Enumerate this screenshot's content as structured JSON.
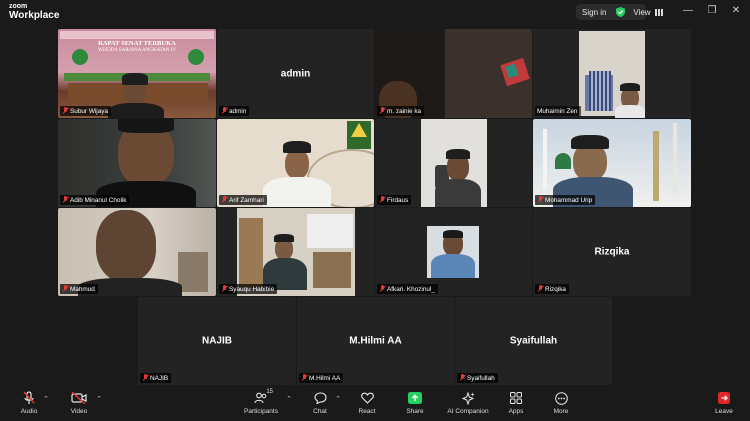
{
  "app": {
    "logo_top": "zoom",
    "logo_bottom": "Workplace"
  },
  "titlebar": {
    "sign_in": "Sign in",
    "view": "View",
    "shield_icon": "shield-check-icon",
    "grid_icon": "grid-icon"
  },
  "participants": [
    {
      "name": "Subur Wijaya",
      "muted": true,
      "video": true
    },
    {
      "name": "admin",
      "muted": true,
      "video": false,
      "display": "admin"
    },
    {
      "name": "m. zainie ka",
      "muted": true,
      "video": true
    },
    {
      "name": "Muhaimin Zen",
      "muted": false,
      "video": true,
      "active": true
    },
    {
      "name": "Adib Minanul Cholik",
      "muted": true,
      "video": true
    },
    {
      "name": "Arif Zamhari",
      "muted": true,
      "video": true
    },
    {
      "name": "Firdaus",
      "muted": true,
      "video": true
    },
    {
      "name": "Mohammad Urip",
      "muted": true,
      "video": true
    },
    {
      "name": "Mahmud",
      "muted": true,
      "video": true
    },
    {
      "name": "Syauqu Habibie",
      "muted": true,
      "video": true
    },
    {
      "name": "Afkari. Khozinul_",
      "muted": true,
      "video": true
    },
    {
      "name": "Rizqika",
      "muted": true,
      "video": false,
      "display": "Rizqika"
    },
    {
      "name": "NAJIB",
      "muted": true,
      "video": false,
      "display": "NAJIB"
    },
    {
      "name": "M.Hilmi AA",
      "muted": true,
      "video": false,
      "display": "M.Hilmi AA"
    },
    {
      "name": "Syaifullah",
      "muted": true,
      "video": false,
      "display": "Syaifullah"
    }
  ],
  "banner": {
    "line1": "RAPAT SENAT TERBUKA",
    "line2": "WISUDA SARJANA ANGKATAN IV"
  },
  "toolbar": {
    "audio": "Audio",
    "video": "Video",
    "participants": "Participants",
    "participants_count": "15",
    "chat": "Chat",
    "react": "React",
    "share": "Share",
    "ai_companion": "AI Companion",
    "apps": "Apps",
    "more": "More",
    "leave": "Leave"
  },
  "colors": {
    "active_border": "#23d160",
    "share_green": "#23d160",
    "leave_red": "#e02828",
    "muted_red": "#e23b3b"
  }
}
